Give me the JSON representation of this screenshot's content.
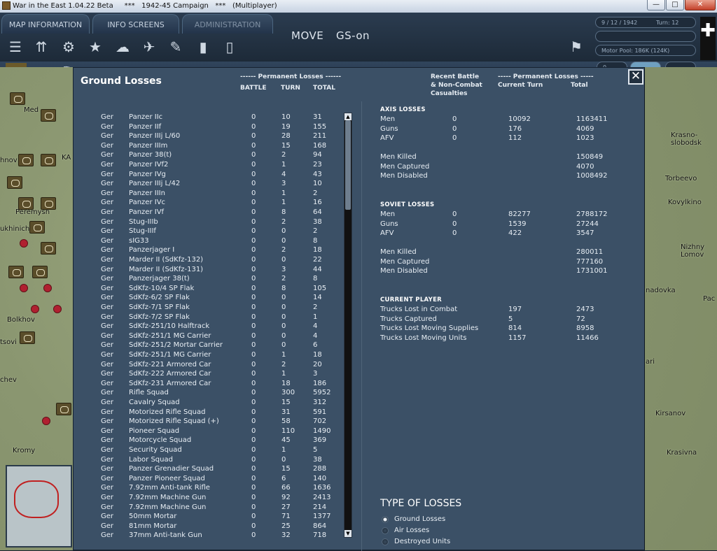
{
  "window": {
    "title": "War in the East 1.04.22 Beta     ***   1942-45 Campaign   ***   (Multiplayer)",
    "min": "—",
    "max": "□",
    "close": "✕"
  },
  "tabs": [
    "MAP INFORMATION",
    "INFO SCREENS",
    "ADMINISTRATION"
  ],
  "mode": {
    "move": "MOVE",
    "gs": "GS-on"
  },
  "status": {
    "date": "9 / 12 / 1942",
    "turn": "Turn: 12",
    "motor_pool": "Motor Pool: 186K (124K)",
    "field4": "0"
  },
  "map_labels": [
    "Med",
    "hnov",
    "KA",
    "Peremysh",
    "ukhinich",
    "Bolkhov",
    "tsovi",
    "chev",
    "Kromy",
    "Krasno-\nslobodsk",
    "Torbeevo",
    "Kovylkino",
    "Nizhny\nLomov",
    "nadovka",
    "Pac",
    "ari",
    "Kirsanov",
    "Krasivna"
  ],
  "panel": {
    "title": "Ground Losses",
    "close": "✕",
    "left_header": {
      "group": "------ Permanent Losses ------",
      "battle": "BATTLE",
      "turn": "TURN",
      "total": "TOTAL"
    },
    "right_header": {
      "recent": "Recent Battle\n& Non-Combat\nCasualties",
      "group": "----- Permanent Losses -----",
      "current": "Current Turn",
      "total": "Total"
    },
    "scroll": {
      "up": "▲",
      "down": "▼"
    },
    "units": [
      [
        "Ger",
        "Panzer IIc",
        "0",
        "10",
        "31"
      ],
      [
        "Ger",
        "Panzer IIf",
        "0",
        "19",
        "155"
      ],
      [
        "Ger",
        "Panzer IIIj L/60",
        "0",
        "28",
        "211"
      ],
      [
        "Ger",
        "Panzer IIIm",
        "0",
        "15",
        "168"
      ],
      [
        "Ger",
        "Panzer 38(t)",
        "0",
        "2",
        "94"
      ],
      [
        "Ger",
        "Panzer IVf2",
        "0",
        "1",
        "23"
      ],
      [
        "Ger",
        "Panzer IVg",
        "0",
        "4",
        "43"
      ],
      [
        "Ger",
        "Panzer IIIj L/42",
        "0",
        "3",
        "10"
      ],
      [
        "Ger",
        "Panzer IIIn",
        "0",
        "1",
        "2"
      ],
      [
        "Ger",
        "Panzer IVc",
        "0",
        "1",
        "16"
      ],
      [
        "Ger",
        "Panzer IVf",
        "0",
        "8",
        "64"
      ],
      [
        "Ger",
        "Stug-IIIb",
        "0",
        "2",
        "38"
      ],
      [
        "Ger",
        "Stug-IIIf",
        "0",
        "0",
        "2"
      ],
      [
        "Ger",
        "sIG33",
        "0",
        "0",
        "8"
      ],
      [
        "Ger",
        "Panzerjager I",
        "0",
        "2",
        "18"
      ],
      [
        "Ger",
        "Marder II (SdKfz-132)",
        "0",
        "0",
        "22"
      ],
      [
        "Ger",
        "Marder II (SdKfz-131)",
        "0",
        "3",
        "44"
      ],
      [
        "Ger",
        "Panzerjager 38(t)",
        "0",
        "2",
        "8"
      ],
      [
        "Ger",
        "SdKfz-10/4 SP Flak",
        "0",
        "8",
        "105"
      ],
      [
        "Ger",
        "SdKfz-6/2 SP Flak",
        "0",
        "0",
        "14"
      ],
      [
        "Ger",
        "SdKfz-7/1 SP Flak",
        "0",
        "0",
        "2"
      ],
      [
        "Ger",
        "SdKfz-7/2 SP Flak",
        "0",
        "0",
        "1"
      ],
      [
        "Ger",
        "SdKfz-251/10 Halftrack",
        "0",
        "0",
        "4"
      ],
      [
        "Ger",
        "SdKfz-251/1 MG Carrier",
        "0",
        "0",
        "4"
      ],
      [
        "Ger",
        "SdKfz-251/2 Mortar Carrier",
        "0",
        "0",
        "6"
      ],
      [
        "Ger",
        "SdKfz-251/1 MG Carrier",
        "0",
        "1",
        "18"
      ],
      [
        "Ger",
        "SdKfz-221 Armored Car",
        "0",
        "2",
        "20"
      ],
      [
        "Ger",
        "SdKfz-222 Armored Car",
        "0",
        "1",
        "3"
      ],
      [
        "Ger",
        "SdKfz-231 Armored Car",
        "0",
        "18",
        "186"
      ],
      [
        "Ger",
        "Rifle Squad",
        "0",
        "300",
        "5952"
      ],
      [
        "Ger",
        "Cavalry Squad",
        "0",
        "15",
        "312"
      ],
      [
        "Ger",
        "Motorized Rifle Squad",
        "0",
        "31",
        "591"
      ],
      [
        "Ger",
        "Motorized Rifle Squad (+)",
        "0",
        "58",
        "702"
      ],
      [
        "Ger",
        "Pioneer Squad",
        "0",
        "110",
        "1490"
      ],
      [
        "Ger",
        "Motorcycle Squad",
        "0",
        "45",
        "369"
      ],
      [
        "Ger",
        "Security Squad",
        "0",
        "1",
        "5"
      ],
      [
        "Ger",
        "Labor Squad",
        "0",
        "0",
        "38"
      ],
      [
        "Ger",
        "Panzer Grenadier Squad",
        "0",
        "15",
        "288"
      ],
      [
        "Ger",
        "Panzer Pioneer Squad",
        "0",
        "6",
        "140"
      ],
      [
        "Ger",
        "7.92mm Anti-tank Rifle",
        "0",
        "66",
        "1636"
      ],
      [
        "Ger",
        "7.92mm Machine Gun",
        "0",
        "92",
        "2413"
      ],
      [
        "Ger",
        "7.92mm Machine Gun",
        "0",
        "27",
        "214"
      ],
      [
        "Ger",
        "50mm Mortar",
        "0",
        "71",
        "1377"
      ],
      [
        "Ger",
        "81mm Mortar",
        "0",
        "25",
        "864"
      ],
      [
        "Ger",
        "37mm Anti-tank Gun",
        "0",
        "32",
        "718"
      ]
    ],
    "axis": {
      "title": "AXIS LOSSES",
      "rows": [
        [
          "Men",
          "0",
          "10092",
          "1163411"
        ],
        [
          "Guns",
          "0",
          "176",
          "4069"
        ],
        [
          "AFV",
          "0",
          "112",
          "1023"
        ]
      ],
      "extra": [
        [
          "Men Killed",
          "150849"
        ],
        [
          "Men Captured",
          "4070"
        ],
        [
          "Men Disabled",
          "1008492"
        ]
      ]
    },
    "soviet": {
      "title": "SOVIET LOSSES",
      "rows": [
        [
          "Men",
          "0",
          "82277",
          "2788172"
        ],
        [
          "Guns",
          "0",
          "1539",
          "27244"
        ],
        [
          "AFV",
          "0",
          "422",
          "3547"
        ]
      ],
      "extra": [
        [
          "Men Killed",
          "280011"
        ],
        [
          "Men Captured",
          "777160"
        ],
        [
          "Men Disabled",
          "1731001"
        ]
      ]
    },
    "player": {
      "title": "CURRENT PLAYER",
      "rows": [
        [
          "Trucks Lost in Combat",
          "197",
          "2473"
        ],
        [
          "Trucks Captured",
          "5",
          "72"
        ],
        [
          "Trucks Lost Moving Supplies",
          "814",
          "8958"
        ],
        [
          "Trucks Lost Moving Units",
          "1157",
          "11466"
        ]
      ]
    },
    "types": {
      "title": "TYPE OF LOSSES",
      "options": [
        "Ground Losses",
        "Air Losses",
        "Destroyed Units"
      ],
      "selected": 0
    }
  }
}
